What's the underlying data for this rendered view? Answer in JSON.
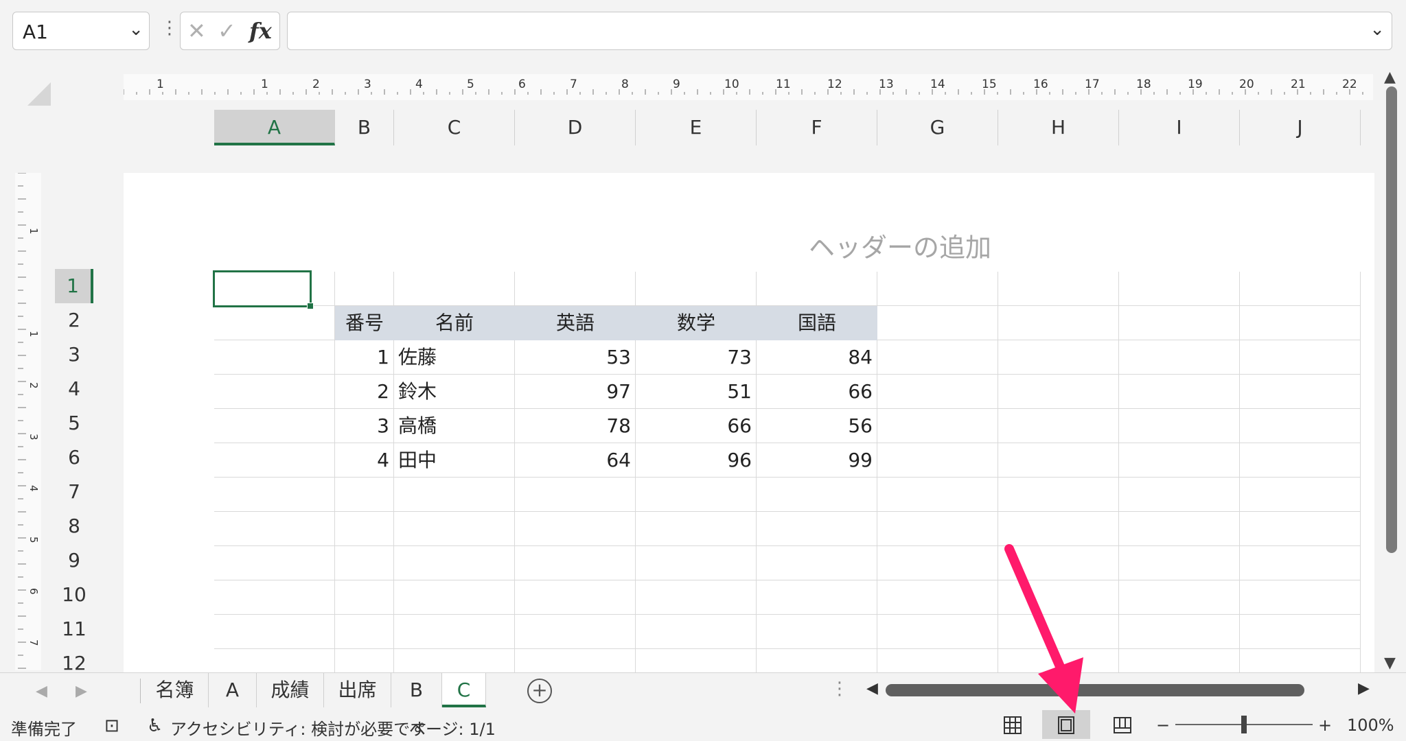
{
  "formula_bar": {
    "name_box": "A1",
    "dots": "⋮",
    "cancel_glyph": "✕",
    "enter_glyph": "✓",
    "fx_glyph": "fx",
    "formula_value": ""
  },
  "ruler": {
    "horizontal_labels": [
      "1",
      "1",
      "2",
      "3",
      "4",
      "5",
      "6",
      "7",
      "8",
      "9",
      "10",
      "11",
      "12",
      "13",
      "14",
      "15",
      "16",
      "17",
      "18",
      "19",
      "20",
      "21",
      "22"
    ],
    "vertical_labels": [
      "1",
      "1",
      "2",
      "3",
      "4",
      "5",
      "6",
      "7"
    ]
  },
  "columns": [
    "A",
    "B",
    "C",
    "D",
    "E",
    "F",
    "G",
    "H",
    "I",
    "J"
  ],
  "rows": [
    "1",
    "2",
    "3",
    "4",
    "5",
    "6",
    "7",
    "8",
    "9",
    "10",
    "11",
    "12"
  ],
  "page": {
    "header_placeholder": "ヘッダーの追加"
  },
  "table": {
    "headers": [
      "番号",
      "名前",
      "英語",
      "数学",
      "国語"
    ],
    "rows": [
      [
        "1",
        "佐藤",
        "53",
        "73",
        "84"
      ],
      [
        "2",
        "鈴木",
        "97",
        "51",
        "66"
      ],
      [
        "3",
        "高橋",
        "78",
        "66",
        "56"
      ],
      [
        "4",
        "田中",
        "64",
        "96",
        "99"
      ]
    ]
  },
  "sheet_tabs": {
    "tabs": [
      "名簿",
      "A",
      "成績",
      "出席",
      "B",
      "C"
    ],
    "active_tab": "C",
    "add_glyph": "+"
  },
  "status_bar": {
    "ready": "準備完了",
    "accessibility": "アクセシビリティ: 検討が必要です",
    "page_count": "ページ: 1/1",
    "zoom_minus": "−",
    "zoom_plus": "+",
    "zoom": "100%"
  },
  "icons": {
    "normal_view": "grid-icon",
    "page_layout_view": "page-layout-icon",
    "page_break_view": "page-break-icon"
  },
  "colors": {
    "accent": "#217346",
    "table_header_fill": "#d6dce4",
    "annotation_arrow": "#ff1a6b"
  }
}
